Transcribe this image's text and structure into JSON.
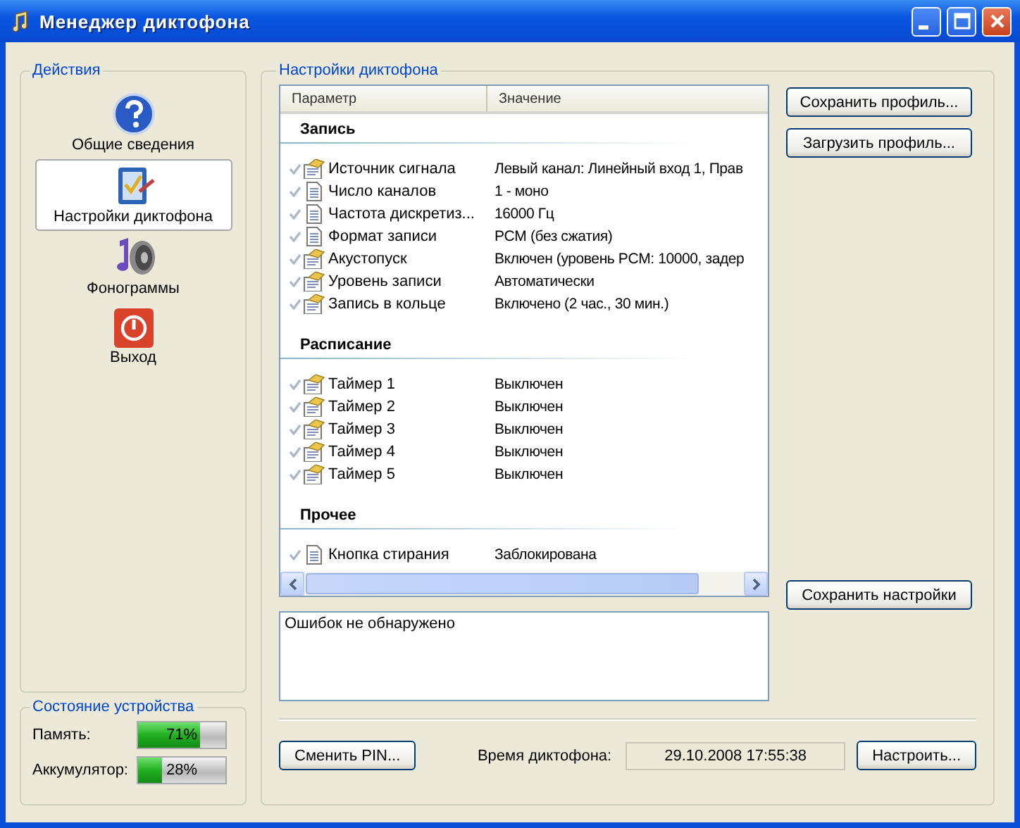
{
  "window": {
    "title": "Менеджер диктофона"
  },
  "actions": {
    "title": "Действия",
    "items": [
      {
        "label": "Общие сведения",
        "kind": "help",
        "selected": false
      },
      {
        "label": "Настройки диктофона",
        "kind": "settings",
        "selected": true
      },
      {
        "label": "Фонограммы",
        "kind": "media",
        "selected": false
      },
      {
        "label": "Выход",
        "kind": "exit",
        "selected": false
      }
    ]
  },
  "device_status": {
    "title": "Состояние устройства",
    "meters": [
      {
        "label": "Память:",
        "level": 0.71,
        "reading": "71%"
      },
      {
        "label": "Аккумулятор:",
        "level": 0.28,
        "reading": "28%"
      }
    ]
  },
  "settings": {
    "title": "Настройки диктофона",
    "table": {
      "columns": [
        "Параметр",
        "Значение"
      ],
      "sections": [
        {
          "title": "Запись",
          "rows": [
            {
              "name": "Источник сигнала",
              "value": "Левый канал: Линейный вход 1, Прав",
              "kind": "properties"
            },
            {
              "name": "Число каналов",
              "value": "1 - моно",
              "kind": "document"
            },
            {
              "name": "Частота дискретиз...",
              "value": "16000 Гц",
              "kind": "document"
            },
            {
              "name": "Формат записи",
              "value": "PCM (без сжатия)",
              "kind": "document"
            },
            {
              "name": "Акустопуск",
              "value": "Включен (уровень PCM: 10000, задер",
              "kind": "properties"
            },
            {
              "name": "Уровень записи",
              "value": "Автоматически",
              "kind": "properties"
            },
            {
              "name": "Запись в кольце",
              "value": "Включено (2 час., 30 мин.)",
              "kind": "properties"
            }
          ]
        },
        {
          "title": "Расписание",
          "rows": [
            {
              "name": "Таймер 1",
              "value": "Выключен",
              "kind": "properties"
            },
            {
              "name": "Таймер 2",
              "value": "Выключен",
              "kind": "properties"
            },
            {
              "name": "Таймер 3",
              "value": "Выключен",
              "kind": "properties"
            },
            {
              "name": "Таймер 4",
              "value": "Выключен",
              "kind": "properties"
            },
            {
              "name": "Таймер 5",
              "value": "Выключен",
              "kind": "properties"
            }
          ]
        },
        {
          "title": "Прочее",
          "rows": [
            {
              "name": "Кнопка стирания",
              "value": "Заблокирована",
              "kind": "document"
            }
          ]
        }
      ]
    },
    "profile_buttons": [
      "Сохранить профиль...",
      "Загрузить профиль..."
    ],
    "save_button": "Сохранить настройки",
    "log": "Ошибок не обнаружено",
    "pin_button": "Сменить PIN...",
    "time_label": "Время диктофона:",
    "time_value": "29.10.2008 17:55:38",
    "set_button": "Настроить..."
  }
}
